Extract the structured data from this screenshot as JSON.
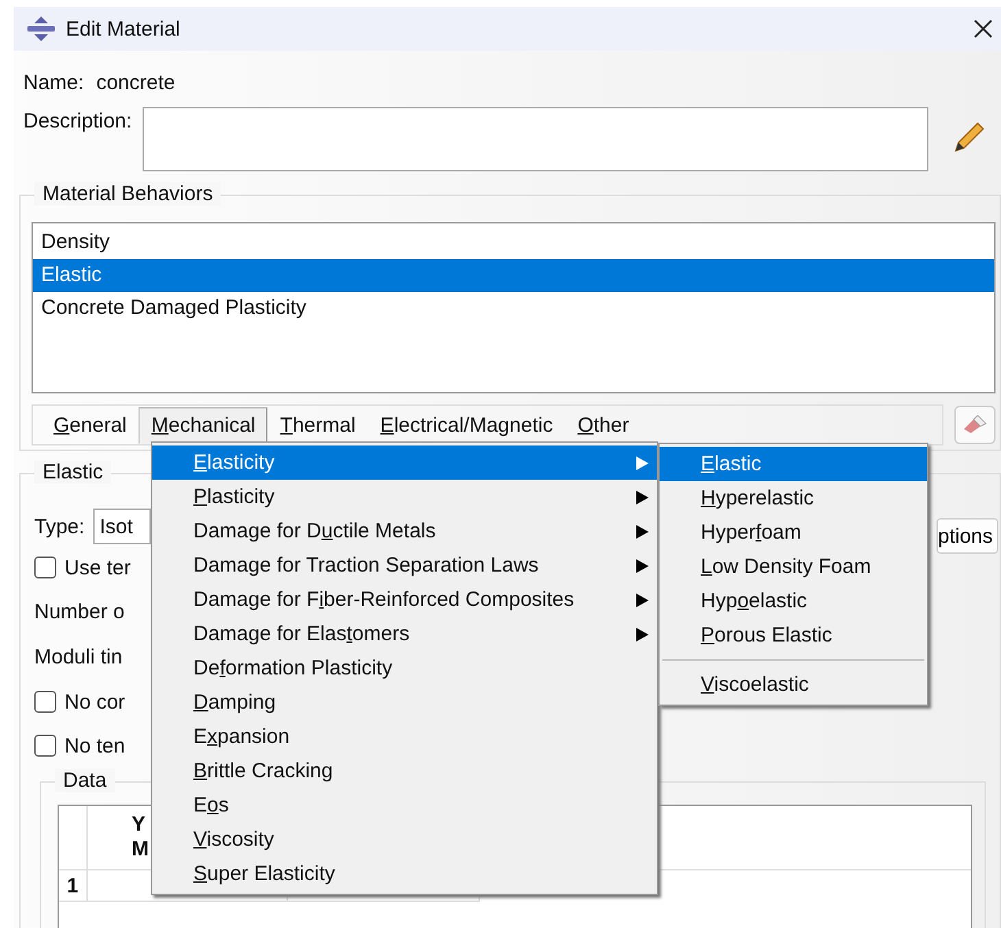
{
  "window": {
    "title": "Edit Material"
  },
  "name": {
    "label": "Name:",
    "value": "concrete"
  },
  "description": {
    "label": "Description:"
  },
  "behaviors": {
    "title": "Material Behaviors",
    "items": [
      {
        "label": "Density",
        "selected": false
      },
      {
        "label": "Elastic",
        "selected": true
      },
      {
        "label": "Concrete Damaged Plasticity",
        "selected": false
      }
    ]
  },
  "menubar": [
    {
      "label": {
        "key": "G",
        "after": "eneral"
      },
      "open": false
    },
    {
      "label": {
        "key": "M",
        "after": "echanical"
      },
      "open": true
    },
    {
      "label": {
        "key": "T",
        "after": "hermal"
      },
      "open": false
    },
    {
      "label": {
        "key": "E",
        "after": "lectrical/Magnetic"
      },
      "open": false
    },
    {
      "label": {
        "key": "O",
        "after": "ther"
      },
      "open": false
    }
  ],
  "mechanical_menu": [
    {
      "label": {
        "key": "E",
        "after": "lasticity"
      },
      "submenu": true,
      "selected": true
    },
    {
      "label": {
        "key": "P",
        "after": "lasticity"
      },
      "submenu": true,
      "selected": false
    },
    {
      "label": {
        "before": "Damage for D",
        "key": "u",
        "after": "ctile Metals"
      },
      "submenu": true,
      "selected": false
    },
    {
      "label": {
        "before": "Dama",
        "key": "g",
        "after": "e for Traction Separation Laws"
      },
      "submenu": true,
      "selected": false
    },
    {
      "label": {
        "before": "Damage for F",
        "key": "i",
        "after": "ber-Reinforced Composites"
      },
      "submenu": true,
      "selected": false
    },
    {
      "label": {
        "before": "Damage for Elas",
        "key": "t",
        "after": "omers"
      },
      "submenu": true,
      "selected": false
    },
    {
      "label": {
        "before": "De",
        "key": "f",
        "after": "ormation Plasticity"
      },
      "submenu": false,
      "selected": false
    },
    {
      "label": {
        "key": "D",
        "after": "amping"
      },
      "submenu": false,
      "selected": false
    },
    {
      "label": {
        "before": "E",
        "key": "x",
        "after": "pansion"
      },
      "submenu": false,
      "selected": false
    },
    {
      "label": {
        "key": "B",
        "after": "rittle Cracking"
      },
      "submenu": false,
      "selected": false
    },
    {
      "label": {
        "before": "E",
        "key": "o",
        "after": "s"
      },
      "submenu": false,
      "selected": false
    },
    {
      "label": {
        "key": "V",
        "after": "iscosity"
      },
      "submenu": false,
      "selected": false
    },
    {
      "label": {
        "key": "S",
        "after": "uper Elasticity"
      },
      "submenu": false,
      "selected": false
    }
  ],
  "elasticity_submenu": [
    {
      "label": {
        "key": "E",
        "after": "lastic"
      },
      "selected": true,
      "separator_before": false
    },
    {
      "label": {
        "key": "H",
        "after": "yperelastic"
      },
      "selected": false,
      "separator_before": false
    },
    {
      "label": {
        "before": "Hyper",
        "key": "f",
        "after": "oam"
      },
      "selected": false,
      "separator_before": false
    },
    {
      "label": {
        "key": "L",
        "after": "ow Density Foam"
      },
      "selected": false,
      "separator_before": false
    },
    {
      "label": {
        "before": "Hyp",
        "key": "o",
        "after": "elastic"
      },
      "selected": false,
      "separator_before": false
    },
    {
      "label": {
        "key": "P",
        "after": "orous Elastic"
      },
      "selected": false,
      "separator_before": false
    },
    {
      "label": {
        "key": "V",
        "after": "iscoelastic"
      },
      "selected": false,
      "separator_before": true
    }
  ],
  "elastic": {
    "title": "Elastic",
    "type_label": "Type:",
    "type_value": "Isot",
    "options_button": "ptions",
    "rows": [
      {
        "kind": "checkbox",
        "label": "Use ter",
        "checked": false
      },
      {
        "kind": "label",
        "label": "Number o"
      },
      {
        "kind": "label",
        "label": "Moduli tin"
      },
      {
        "kind": "checkbox",
        "label": "No cor",
        "checked": false
      },
      {
        "kind": "checkbox",
        "label": "No ten",
        "checked": false
      }
    ]
  },
  "data": {
    "title": "Data",
    "columns": [
      {
        "lines": [
          "Y",
          "M"
        ]
      }
    ],
    "rows": [
      {
        "number": "1"
      }
    ]
  }
}
